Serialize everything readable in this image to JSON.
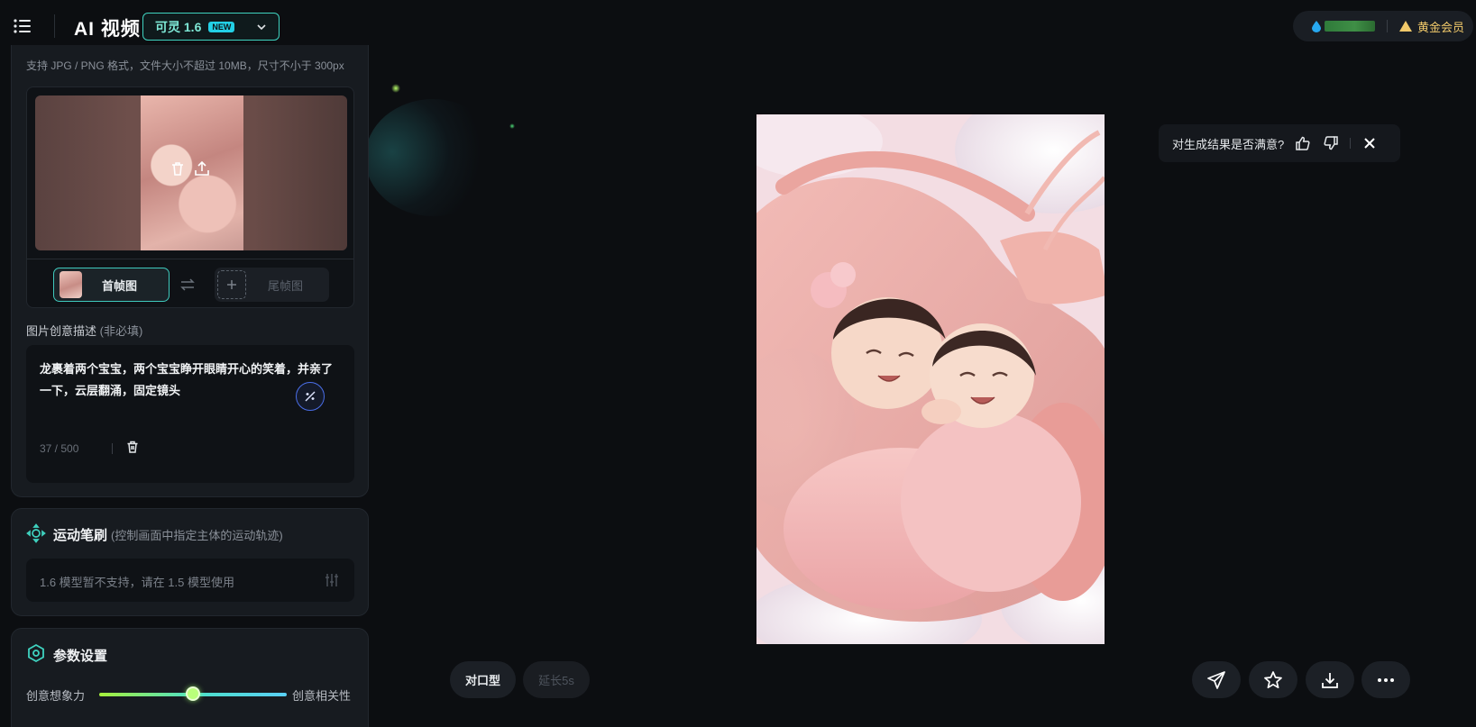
{
  "header": {
    "app_title": "AI 视频",
    "model": {
      "label": "可灵 1.6",
      "badge": "NEW"
    },
    "account": {
      "membership": "黄金会员"
    }
  },
  "upload": {
    "hint": "支持 JPG / PNG 格式，文件大小不超过 10MB，尺寸不小于 300px",
    "tabs": {
      "first_frame": "首帧图",
      "last_frame": "尾帧图"
    }
  },
  "description": {
    "title": "图片创意描述",
    "optional": "(非必填)",
    "text": "龙裹着两个宝宝，两个宝宝睁开眼睛开心的笑着，并亲了一下，云层翻涌，固定镜头",
    "count": "37 / 500"
  },
  "motion_brush": {
    "title": "运动笔刷",
    "subtitle": "(控制画面中指定主体的运动轨迹)",
    "note": "1.6 模型暂不支持，请在 1.5 模型使用"
  },
  "params": {
    "title": "参数设置",
    "slider_left": "创意想象力",
    "slider_right": "创意相关性",
    "slider_value": 0.5
  },
  "feedback": {
    "question": "对生成结果是否满意?"
  },
  "actions": {
    "lip_sync": "对口型",
    "extend": "延长5s"
  },
  "colors": {
    "accent": "#3fd3c0",
    "badge": "#23d0e6",
    "vip_gold": "#f1c96a",
    "background": "#0c0e11"
  },
  "icons": [
    "menu-icon",
    "chevron-down-icon",
    "drop-icon",
    "crown-icon",
    "trash-icon",
    "upload-icon",
    "swap-icon",
    "plus-icon",
    "wand-icon",
    "motion-brush-icon",
    "sliders-icon",
    "settings-hex-icon",
    "thumbs-up-icon",
    "thumbs-down-icon",
    "close-icon",
    "send-icon",
    "star-icon",
    "download-icon",
    "more-icon"
  ]
}
